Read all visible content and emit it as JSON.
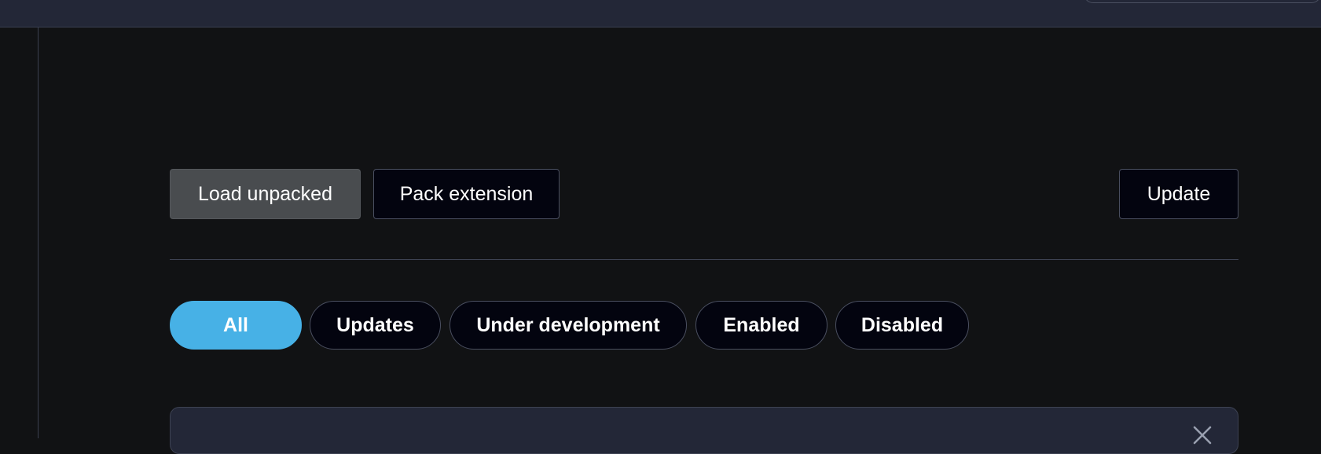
{
  "toolbar": {
    "load_unpacked_label": "Load unpacked",
    "pack_extension_label": "Pack extension",
    "update_label": "Update"
  },
  "filters": {
    "chips": [
      {
        "label": "All",
        "active": true
      },
      {
        "label": "Updates",
        "active": false
      },
      {
        "label": "Under development",
        "active": false
      },
      {
        "label": "Enabled",
        "active": false
      },
      {
        "label": "Disabled",
        "active": false
      }
    ]
  },
  "card": {
    "close_icon": "close-icon"
  },
  "colors": {
    "background": "#111214",
    "topbar": "#232737",
    "accent": "#47b1e6",
    "button_dark": "#03040f",
    "button_gray": "#494c4f",
    "border": "#4a4f60"
  }
}
